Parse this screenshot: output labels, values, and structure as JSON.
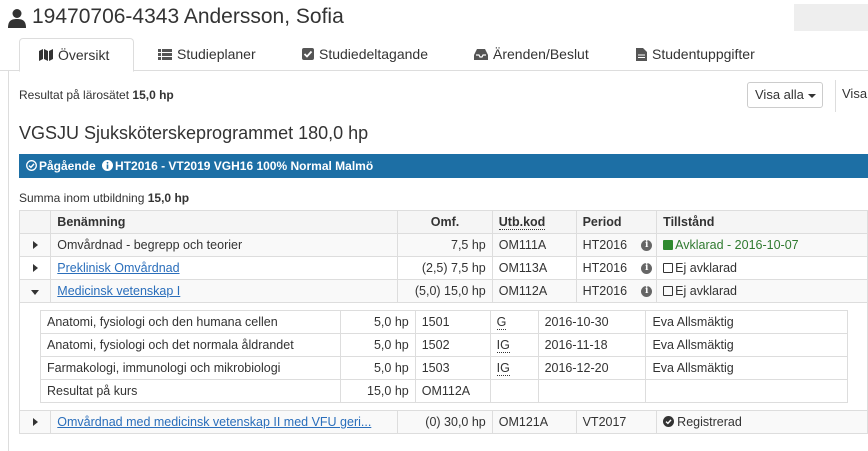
{
  "header": {
    "title": "19470706-4343 Andersson, Sofia",
    "icon": "user-icon"
  },
  "tabs": [
    {
      "label": "Översikt",
      "icon": "map-icon",
      "active": true
    },
    {
      "label": "Studieplaner",
      "icon": "list-icon",
      "active": false
    },
    {
      "label": "Studiedeltagande",
      "icon": "check-square-icon",
      "active": false
    },
    {
      "label": "Ärenden/Beslut",
      "icon": "inbox-icon",
      "active": false
    },
    {
      "label": "Studentuppgifter",
      "icon": "file-icon",
      "active": false
    }
  ],
  "summary": {
    "result_label": "Resultat på lärosätet",
    "result_value": "15,0 hp",
    "visa_button": "Visa alla",
    "visa_button2": "Visa"
  },
  "program": {
    "title": "VGSJU Sjuksköterskeprogrammet 180,0 hp",
    "status_label": "Pågående",
    "status_detail": "HT2016 - VT2019 VGH16 100% Normal Malmö",
    "summa_label": "Summa inom utbildning",
    "summa_value": "15,0 hp"
  },
  "table": {
    "headers": {
      "name": "Benämning",
      "omf": "Omf.",
      "code": "Utb.kod",
      "period": "Period",
      "state": "Tillstånd"
    },
    "rows": [
      {
        "name": "Omvårdnad - begrepp och teorier",
        "omf": "7,5 hp",
        "code": "OM111A",
        "period": "HT2016",
        "state": "Avklarad - 2016-10-07"
      },
      {
        "name": "Preklinisk Omvårdnad",
        "omf": "(2,5) 7,5 hp",
        "code": "OM113A",
        "period": "HT2016",
        "state": "Ej avklarad"
      },
      {
        "name": "Medicinsk vetenskap I",
        "omf": "(5,0) 15,0 hp",
        "code": "OM112A",
        "period": "HT2016",
        "state": "Ej avklarad"
      },
      {
        "name": "Omvårdnad med medicinsk vetenskap II med VFU geri...",
        "omf": "(0) 30,0 hp",
        "code": "OM121A",
        "period": "VT2017",
        "state": "Registrerad"
      }
    ],
    "subrows": [
      {
        "name": "Anatomi, fysiologi och den humana cellen",
        "omf": "5,0 hp",
        "code": "1501",
        "grade": "G",
        "date": "2016-10-30",
        "examiner": "Eva Allsmäktig"
      },
      {
        "name": "Anatomi, fysiologi och det normala åldrandet",
        "omf": "5,0 hp",
        "code": "1502",
        "grade": "IG",
        "date": "2016-11-18",
        "examiner": "Eva Allsmäktig"
      },
      {
        "name": "Farmakologi, immunologi och mikrobiologi",
        "omf": "5,0 hp",
        "code": "1503",
        "grade": "IG",
        "date": "2016-12-20",
        "examiner": "Eva Allsmäktig"
      },
      {
        "name": "Resultat på kurs",
        "omf": "15,0 hp",
        "code": "OM112A",
        "grade": "",
        "date": "",
        "examiner": ""
      }
    ]
  },
  "colors": {
    "status_bar": "#1d6fa5",
    "link": "#2a6ebb",
    "passed": "#2f8a2f"
  }
}
